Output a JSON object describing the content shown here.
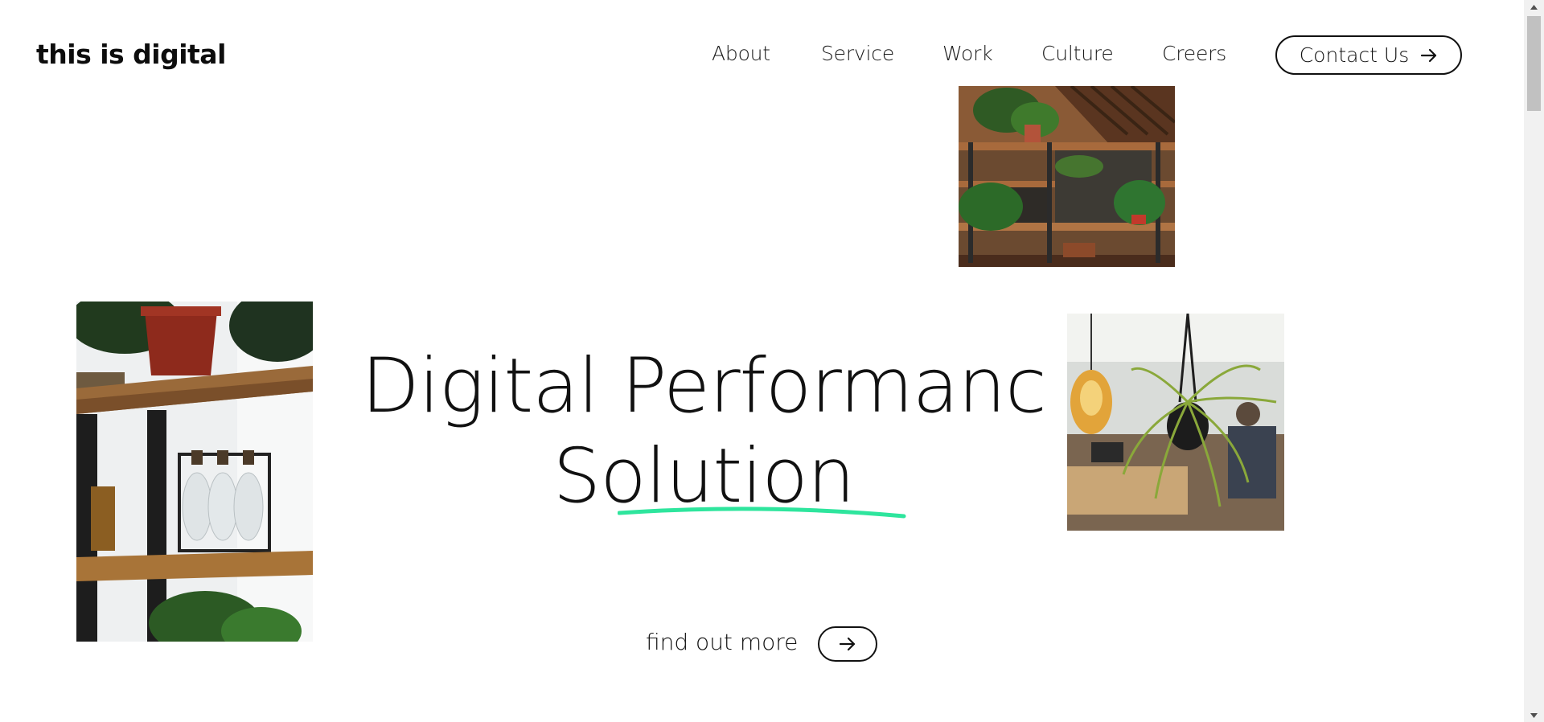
{
  "brand": {
    "logo_text": "this is digital"
  },
  "nav": {
    "items": [
      {
        "label": "About"
      },
      {
        "label": "Service"
      },
      {
        "label": "Work"
      },
      {
        "label": "Culture"
      },
      {
        "label": "Creers"
      }
    ],
    "contact_label": "Contact Us",
    "contact_icon": "arrow-right-icon"
  },
  "hero": {
    "title_line1": "Digital Performanc",
    "title_line2": "Solution",
    "underline_color": "#2ee59d",
    "cta_label": "find out more",
    "cta_icon": "arrow-right-icon"
  },
  "images": [
    {
      "name": "office-shelves-plants-photo"
    },
    {
      "name": "shelf-with-pot-and-bottles-photo"
    },
    {
      "name": "hanging-plant-and-bulb-photo"
    }
  ],
  "colors": {
    "text": "#111111",
    "background": "#ffffff",
    "accent": "#2ee59d"
  }
}
